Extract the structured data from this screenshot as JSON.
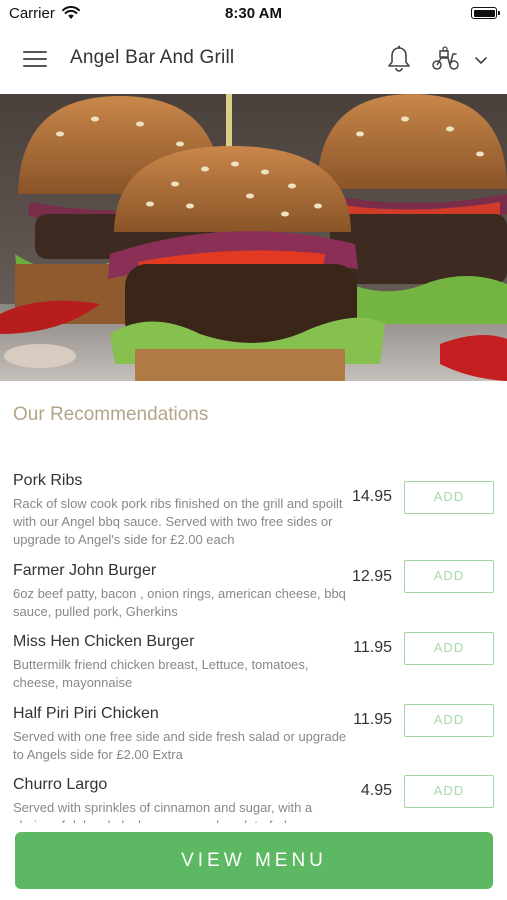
{
  "status_bar": {
    "carrier": "Carrier",
    "time": "8:30 AM"
  },
  "header": {
    "title": "Angel Bar And Grill",
    "icons": [
      "hamburger-menu-icon",
      "bell-icon",
      "delivery-scooter-icon",
      "chevron-down-icon"
    ]
  },
  "hero": {
    "image": "burger-photo"
  },
  "recommendations": {
    "title": "Our Recommendations",
    "items": [
      {
        "name": "Pork Ribs",
        "description": "Rack of slow cook pork ribs finished on the grill and spoilt with our Angel bbq sauce. Served with two free sides or upgrade to Angel's side for £2.00 each",
        "price": "14.95",
        "add_label": "ADD"
      },
      {
        "name": "Farmer John Burger",
        "description": "6oz beef patty, bacon , onion rings, american cheese, bbq sauce, pulled pork, Gherkins",
        "price": "12.95",
        "add_label": "ADD"
      },
      {
        "name": "Miss Hen Chicken Burger",
        "description": "Buttermilk friend chicken breast, Lettuce, tomatoes, cheese, mayonnaise",
        "price": "11.95",
        "add_label": "ADD"
      },
      {
        "name": "Half Piri Piri Chicken",
        "description": "Served with one free side and side fresh salad or upgrade to Angels side for £2.00 Extra",
        "price": "11.95",
        "add_label": "ADD"
      },
      {
        "name": "Churro Largo",
        "description": "Served with sprinkles of cinnamon and sugar, with a choice of dulce de leche sauce or chocolate fudge",
        "price": "4.95",
        "add_label": "ADD"
      }
    ]
  },
  "cta": {
    "label": "VIEW MENU"
  },
  "colors": {
    "accent_green": "#5cb863",
    "add_border": "#9fd6a3",
    "section_title": "#b4a488"
  }
}
